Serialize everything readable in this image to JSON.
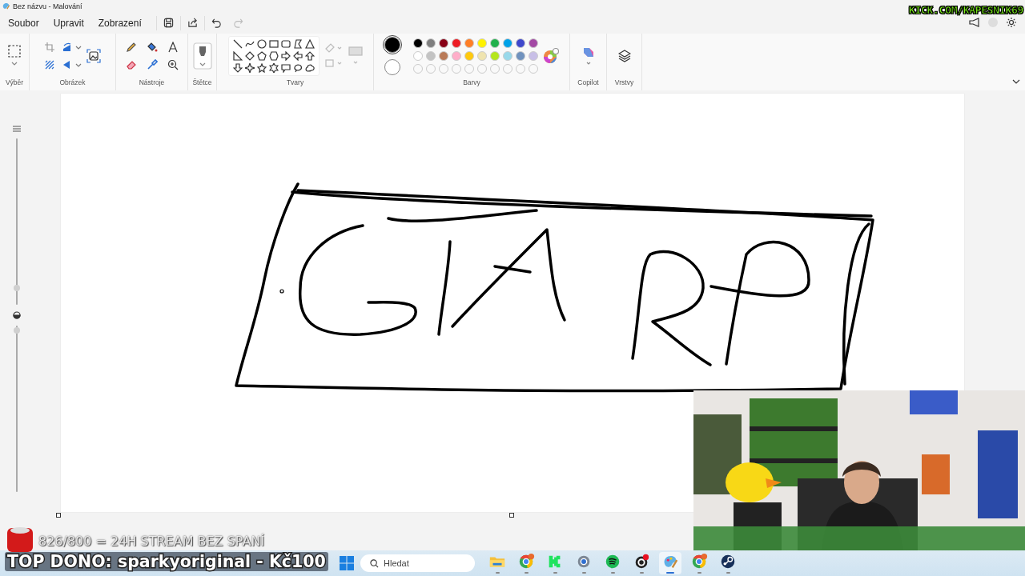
{
  "window": {
    "title": "Bez názvu - Malování"
  },
  "menu": [
    "Soubor",
    "Upravit",
    "Zobrazení"
  ],
  "ribbon_groups": [
    "Výběr",
    "Obrázek",
    "Nástroje",
    "Štětce",
    "Tvary",
    "Barvy",
    "Copilot",
    "Vrstvy"
  ],
  "colors": {
    "primary": {
      "color": "#000000",
      "selected": true
    },
    "secondary": {
      "color": "#ffffff",
      "selected": false
    },
    "palette": [
      {
        "color": "#000000"
      },
      {
        "color": "#7f7f7f"
      },
      {
        "color": "#880015"
      },
      {
        "color": "#ed1c24"
      },
      {
        "color": "#ff7f27"
      },
      {
        "color": "#fff200"
      },
      {
        "color": "#22b14c"
      },
      {
        "color": "#00a2e8"
      },
      {
        "color": "#3f48cc"
      },
      {
        "color": "#a349a4"
      },
      {
        "color": "#ffffff"
      },
      {
        "color": "#c3c3c3"
      },
      {
        "color": "#b97a57"
      },
      {
        "color": "#ffaec9"
      },
      {
        "color": "#ffc90e"
      },
      {
        "color": "#efe4b0"
      },
      {
        "color": "#b5e61d"
      },
      {
        "color": "#99d9ea"
      },
      {
        "color": "#7092be"
      },
      {
        "color": "#c8bfe7"
      }
    ]
  },
  "side_sliders": [
    {
      "level": 0.1
    },
    {
      "level": 0.97
    }
  ],
  "overlay": {
    "channel": "KICK.COM/KAPESNIK69",
    "goal": "826/800 = 24H STREAM BEZ SPANÍ",
    "top_donation": "TOP DONO: sparkyoriginal - Kč100"
  },
  "taskbar": {
    "search_placeholder": "Hledat",
    "apps": [
      {
        "kind": "explorer",
        "selected": false
      },
      {
        "kind": "chrome",
        "selected": false
      },
      {
        "kind": "kick",
        "selected": false
      },
      {
        "kind": "settings",
        "selected": false
      },
      {
        "kind": "spotify",
        "selected": false
      },
      {
        "kind": "obs",
        "selected": false
      },
      {
        "kind": "paint",
        "selected": true
      },
      {
        "kind": "chrome",
        "selected": false
      },
      {
        "kind": "steam",
        "selected": false
      }
    ]
  }
}
